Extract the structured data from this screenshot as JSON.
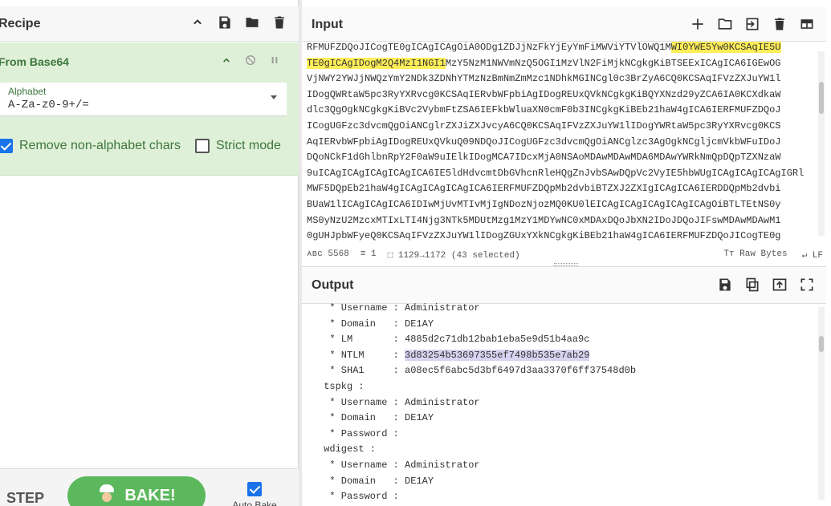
{
  "recipe": {
    "title": "Recipe",
    "operation": {
      "title": "From Base64",
      "alphabet_label": "Alphabet",
      "alphabet_value": "A-Za-z0-9+/=",
      "remove_nonalpha_label": "Remove non-alphabet chars",
      "remove_nonalpha_checked": true,
      "strict_mode_label": "Strict mode",
      "strict_mode_checked": false
    },
    "step_label": "STEP",
    "bake_label": "BAKE!",
    "autobake_label": "Auto Bake",
    "autobake_checked": true
  },
  "input": {
    "title": "Input",
    "lines": [
      "RFMUFZDQoJICogTE0gICAgICAgOiA0ODg1ZDJjNzFkYjEyYmFiMWViYTVlOWQ1M",
      "TE0gICAgIDogM2Q4MzI1NGI1",
      "VjNWY2YWJjNWQzYmY2NDk3ZDNhYTMzNzBmNmZmMzc1NDhkMGINCgl0c3BrZyA6CQ0KCSAqIFVzZXJuYW1l",
      "IDogQWRtaW5pc3RyYXRvcg0KCSAqIERvbWFpbiAgIDogREUxQVkNCgkgKiBQYXNzd29yZCA6IA0KCXdkaW",
      "dlc3QgOgkNCgkgKiBVc2VybmFtZSA6IEFkbWluaXN0cmF0b3INCgkgKiBEb21haW4gICA6IERFMUFZDQoJ",
      "ICogUGFzc3dvcmQgOiANCglrZXJiZXJvcyA6CQ0KCSAqIFVzZXJuYW1lIDogYWRtaW5pc3RyYXRvcg0KCS",
      "AqIERvbWFpbiAgIDogREUxQVkuQ09NDQoJICogUGFzc3dvcmQgOiANCglzc3AgOgkNCgljcmVkbWFuIDoJ",
      "DQoNCkF1dGhlbnRpY2F0aW9uIElkIDogMCA7IDcxMjA0NSAoMDAwMDAwMDA6MDAwYWRkNmQpDQpTZXNzaW",
      "9uICAgICAgICAgICAgICA6IE5ldHdvcmtDbGVhcnRleHQgZnJvbSAwDQpVc2VyIE5hbWUgICAgICAgICAgIGRl",
      "MWF5DQpEb21haW4gICAgICAgICAgICA6IERFMUFZDQpMb2dvbiBTZXJ2ZXIgICAgICA6IERDDQpMb2dvbi",
      "BUaW1lICAgICAgICA6IDIwMjUvMTIvMjIgNDozNjozMQ0KU0lEICAgICAgICAgICAgICAgOiBTLTEtNS0y",
      "MS0yNzU2MzcxMTIxLTI4Njg3NTk5MDUtMzg1MzY1MDYwNC0xMDAxDQoJbXN2IDoJDQoJIFswMDAwMDAwM1",
      "0gUHJpbWFyeQ0KCSAqIFVzZXJuYW1lIDogZGUxYXkNCgkgKiBEb21haW4gICA6IERFMUFZDQoJICogTE0g"
    ],
    "line1_highlight": "WI0YWE5Yw0KCSAqIE5U",
    "line2_rest": "MzY5NzM1NWVmNzQ5OGI1MzVlN2FiMjkNCgkgKiBTSEExICAgICA6IGEwOG",
    "status_length": "5568",
    "status_lines": "1",
    "status_selection": "1129→1172 (43 selected)",
    "status_raw_bytes": "Raw Bytes",
    "status_eol": "LF"
  },
  "output": {
    "title": "Output",
    "lines": [
      "  * Username : Administrator",
      "  * Domain   : DE1AY",
      "  * LM       : 4885d2c71db12bab1eba5e9d51b4aa9c",
      "  * NTLM     : ",
      "  * SHA1     : a08ec5f6abc5d3bf6497d3aa3370f6ff37548d0b",
      " tspkg :",
      "  * Username : Administrator",
      "  * Domain   : DE1AY",
      "  * Password :",
      " wdigest :",
      "  * Username : Administrator",
      "  * Domain   : DE1AY",
      "  * Password :"
    ],
    "ntlm_hash": "3d83254b53697355ef7498b535e7ab29"
  },
  "colors": {
    "operation_bg": "#dff0d8",
    "operation_text": "#3c763d",
    "bake_green": "#5cb85c",
    "highlight_yellow": "#ffee58",
    "highlight_purple": "#d7d3f0"
  }
}
